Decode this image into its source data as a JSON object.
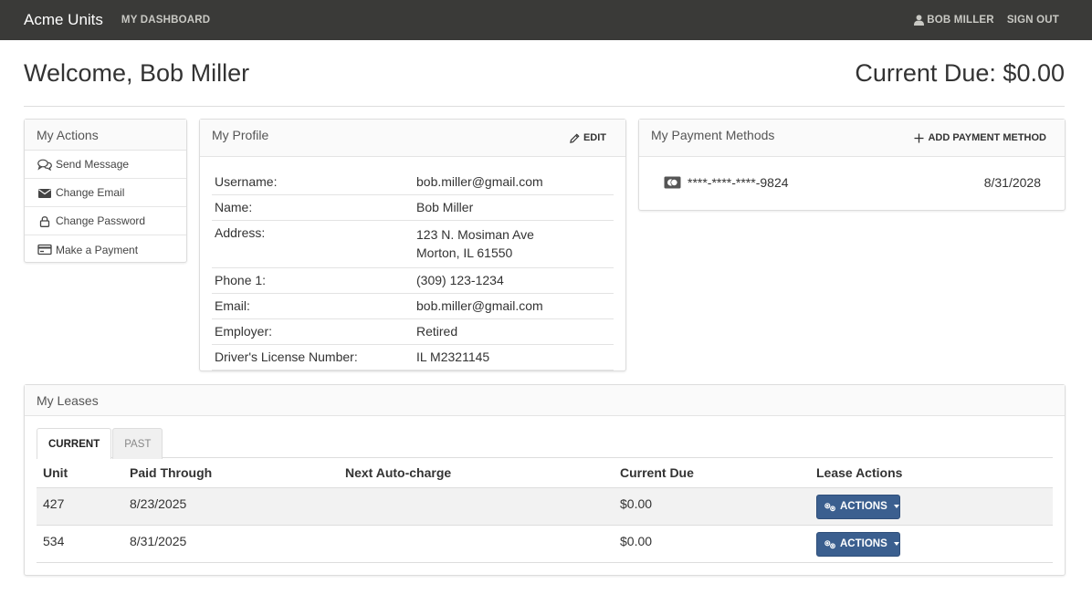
{
  "nav": {
    "brand": "Acme Units",
    "dashboard": "MY DASHBOARD",
    "user": "BOB MILLER",
    "sign_out": "SIGN OUT"
  },
  "header": {
    "welcome": "Welcome, Bob Miller",
    "current_due": "Current Due: $0.00"
  },
  "actions": {
    "title": "My Actions",
    "items": [
      {
        "label": "Send Message",
        "icon": "chat-icon"
      },
      {
        "label": "Change Email",
        "icon": "envelope-icon"
      },
      {
        "label": "Change Password",
        "icon": "lock-icon"
      },
      {
        "label": "Make a Payment",
        "icon": "credit-card-icon"
      }
    ]
  },
  "profile": {
    "title": "My Profile",
    "edit_label": "EDIT",
    "rows": [
      {
        "label": "Username:",
        "value": "bob.miller@gmail.com"
      },
      {
        "label": "Name:",
        "value": "Bob Miller"
      },
      {
        "label": "Address:",
        "value": "123 N. Mosiman Ave",
        "value2": "Morton, IL 61550"
      },
      {
        "label": "Phone 1:",
        "value": "(309) 123-1234"
      },
      {
        "label": "Email:",
        "value": "bob.miller@gmail.com"
      },
      {
        "label": "Employer:",
        "value": "Retired"
      },
      {
        "label": "Driver's License Number:",
        "value": "IL M2321145"
      }
    ]
  },
  "payment": {
    "title": "My Payment Methods",
    "add_label": "ADD PAYMENT METHOD",
    "card_number": "****-****-****-9824",
    "card_exp": "8/31/2028"
  },
  "leases": {
    "title": "My Leases",
    "tabs": [
      "CURRENT",
      "PAST"
    ],
    "columns": [
      "Unit",
      "Paid Through",
      "Next Auto-charge",
      "Current Due",
      "Lease Actions"
    ],
    "rows": [
      {
        "unit": "427",
        "paid_through": "8/23/2025",
        "next_auto": "",
        "current_due": "$0.00",
        "action": "ACTIONS"
      },
      {
        "unit": "534",
        "paid_through": "8/31/2025",
        "next_auto": "",
        "current_due": "$0.00",
        "action": "ACTIONS"
      }
    ]
  },
  "colors": {
    "navbar": "#3a3a38",
    "phone_link": "#8ab84c",
    "action_button": "#3b5f8f"
  }
}
